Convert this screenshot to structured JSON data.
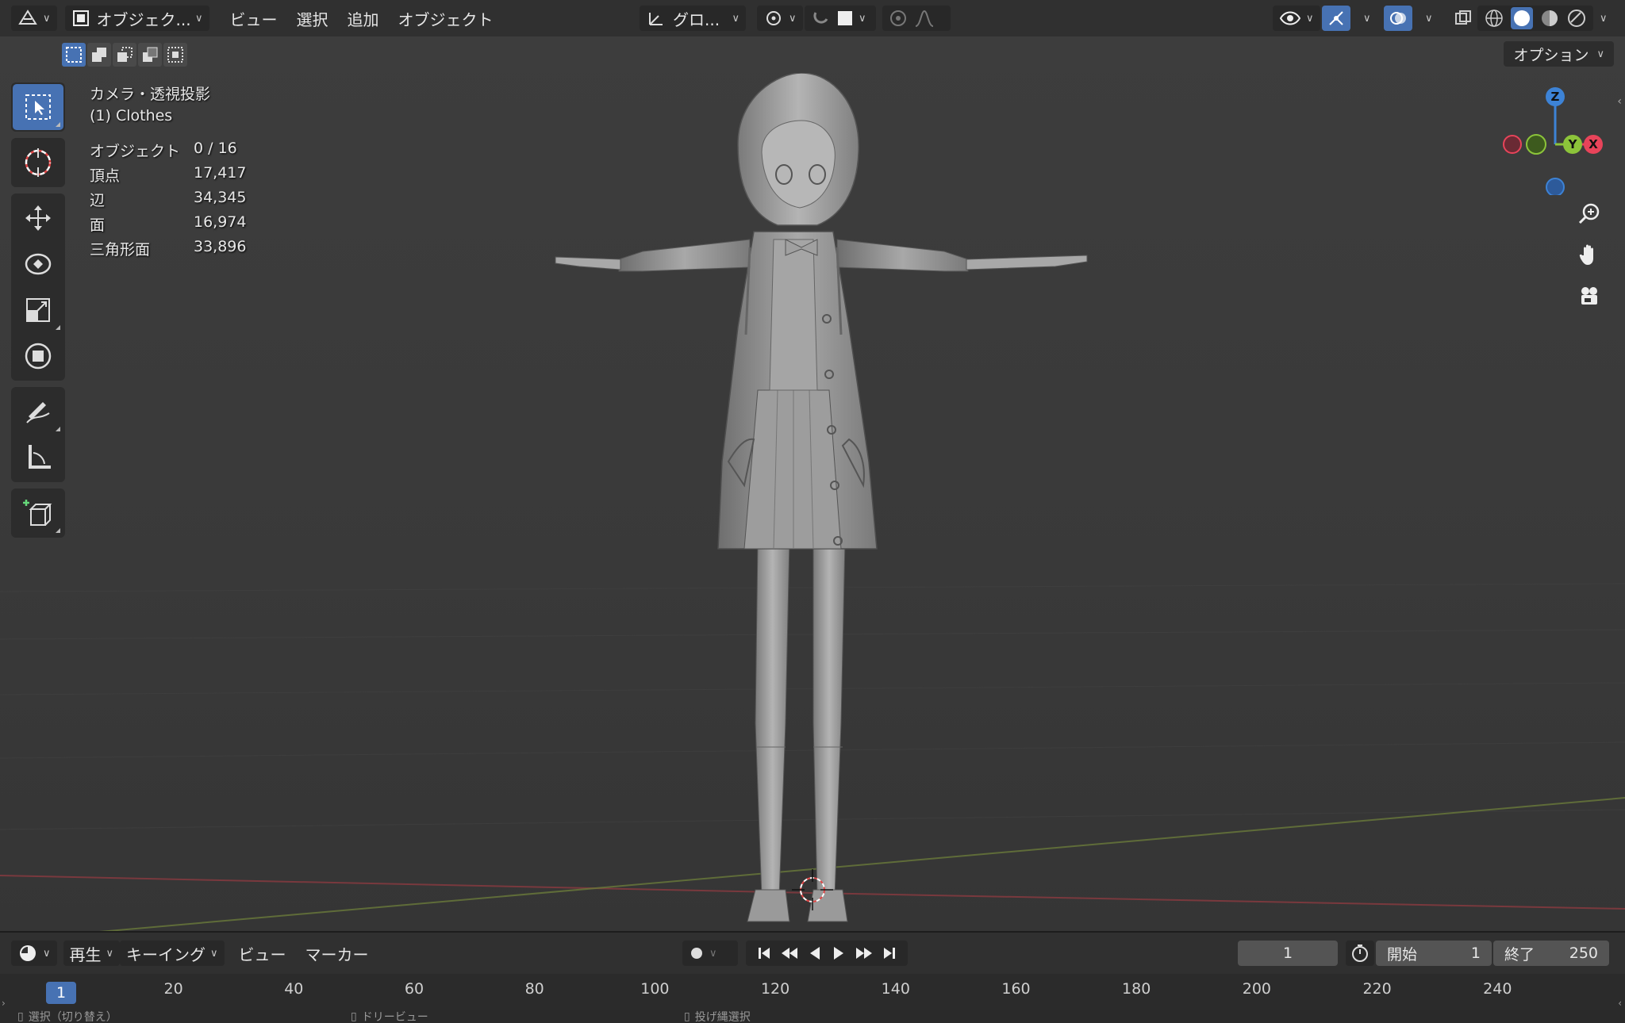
{
  "header": {
    "mode_label": "オブジェク...",
    "menus": [
      "ビュー",
      "選択",
      "追加",
      "オブジェクト"
    ],
    "transform_orientation": "グロ..."
  },
  "viewport": {
    "options_label": "オプション",
    "camera_label": "カメラ・透視投影",
    "collection_label": "(1) Clothes",
    "stats": [
      {
        "label": "オブジェクト",
        "value": "0 / 16"
      },
      {
        "label": "頂点",
        "value": "17,417"
      },
      {
        "label": "辺",
        "value": "34,345"
      },
      {
        "label": "面",
        "value": "16,974"
      },
      {
        "label": "三角形面",
        "value": "33,896"
      }
    ],
    "gizmo": {
      "z": "Z",
      "y": "Y",
      "x": "X"
    }
  },
  "timeline": {
    "menus": [
      "再生",
      "キーイング",
      "ビュー",
      "マーカー"
    ],
    "current_frame": "1",
    "start_label": "開始",
    "start_value": "1",
    "end_label": "終了",
    "end_value": "250",
    "ruler_current": "1",
    "ruler_ticks": [
      "20",
      "40",
      "60",
      "80",
      "100",
      "120",
      "140",
      "160",
      "180",
      "200",
      "220",
      "240"
    ]
  },
  "statusbar": {
    "items": [
      "選択（切り替え）",
      "ドリービュー",
      "投げ縄選択"
    ]
  },
  "colors": {
    "accent": "#4772b3",
    "axis_x": "#e8445a",
    "axis_y": "#8cc43a",
    "axis_z": "#3d83d6"
  }
}
